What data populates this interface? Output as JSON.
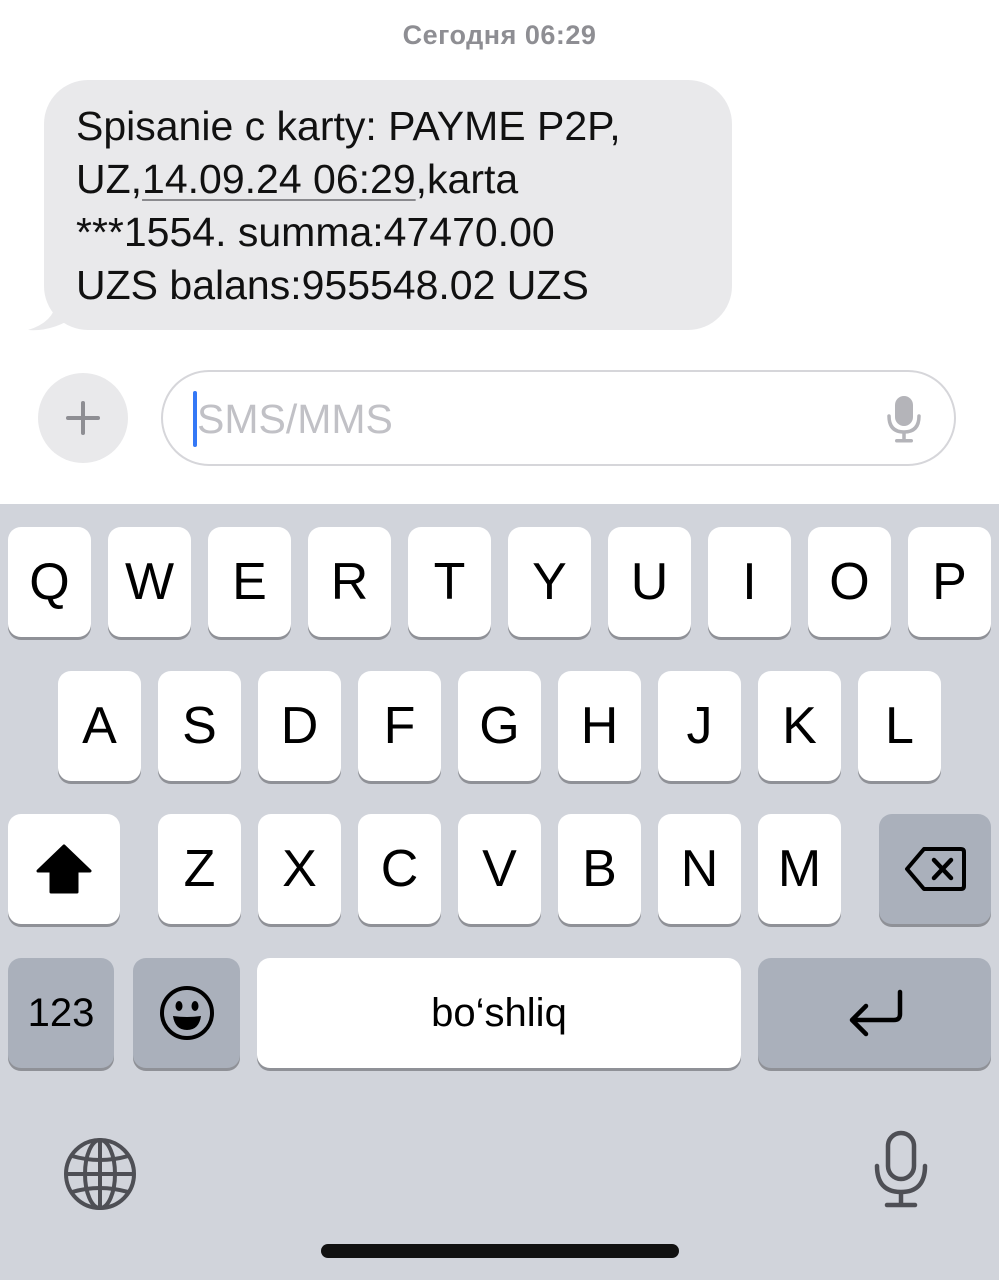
{
  "conversation": {
    "timestamp": "Сегодня 06:29",
    "message": {
      "line1": "Spisanie c karty: PAYME P2P,",
      "line2_prefix": "UZ,",
      "line2_link": "14.09.24 06:29",
      "line2_suffix": ",karta",
      "line3": "***1554. summa:47470.00",
      "line4": "UZS balans:955548.02 UZS"
    }
  },
  "composer": {
    "placeholder": "SMS/MMS"
  },
  "keyboard": {
    "row1": [
      "Q",
      "W",
      "E",
      "R",
      "T",
      "Y",
      "U",
      "I",
      "O",
      "P"
    ],
    "row2": [
      "A",
      "S",
      "D",
      "F",
      "G",
      "H",
      "J",
      "K",
      "L"
    ],
    "row3": [
      "Z",
      "X",
      "C",
      "V",
      "B",
      "N",
      "M"
    ],
    "numbers_label": "123",
    "space_label": "bo‘shliq"
  },
  "icons": {
    "plus": "plus-icon",
    "composer_mic": "microphone-icon",
    "shift": "shift-arrow-icon",
    "backspace": "backspace-icon",
    "emoji": "emoji-icon",
    "return": "return-arrow-icon",
    "globe": "globe-icon",
    "dictation": "dictation-mic-icon"
  },
  "colors": {
    "bubble_background": "#e9e9eb",
    "keyboard_background": "#d1d4db",
    "key_background": "#ffffff",
    "function_key_background": "#aab0bb",
    "caret": "#3478f6",
    "timestamp_text": "#8e8e93"
  }
}
